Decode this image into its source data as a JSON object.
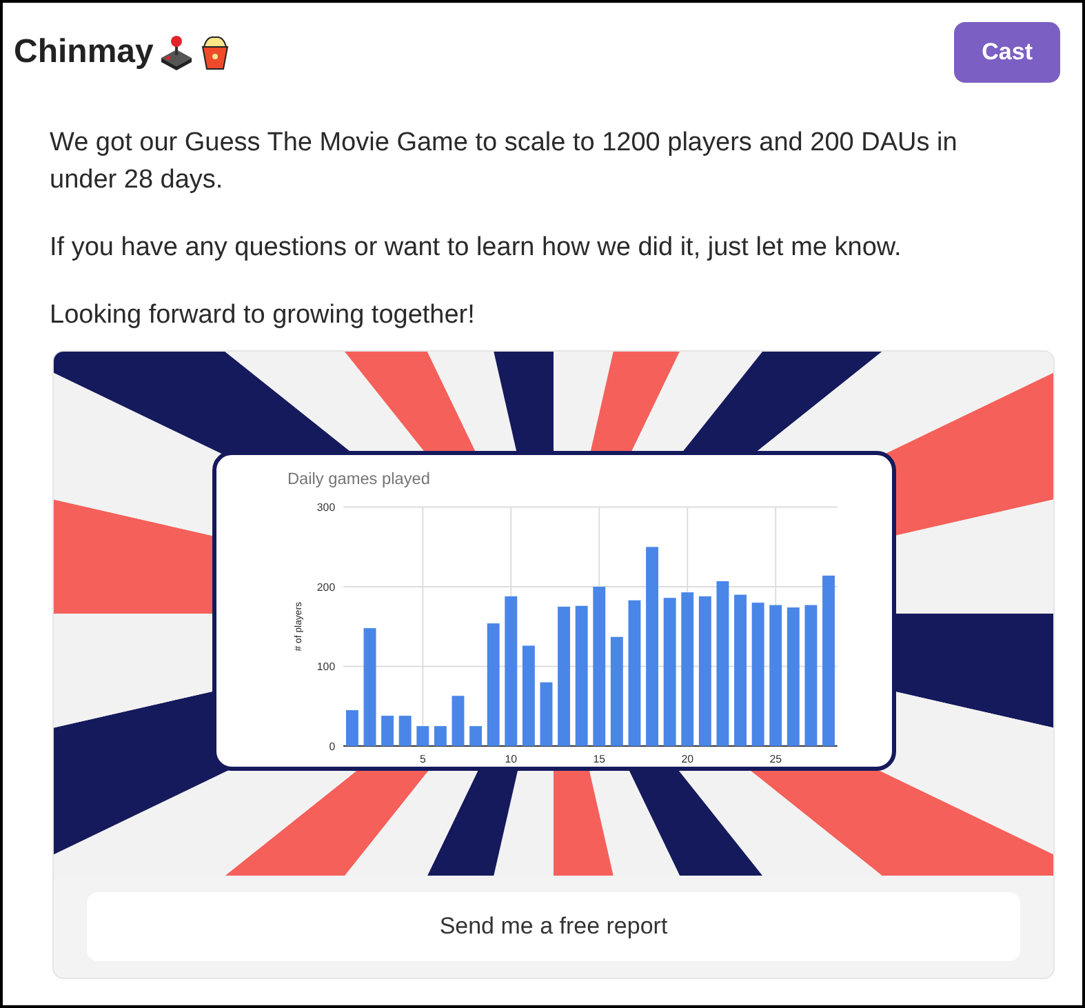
{
  "header": {
    "name": "Chinmay",
    "cast_button": "Cast"
  },
  "post": {
    "paragraphs": [
      "We got our Guess The Movie Game to scale to 1200 players and 200 DAUs in under 28 days.",
      "If you have any questions or want to learn how we did it, just let me know.",
      "Looking forward to growing together!"
    ]
  },
  "embed": {
    "chart_data": {
      "type": "bar",
      "title": "Daily games played",
      "ylabel": "# of players",
      "x": [
        1,
        2,
        3,
        4,
        5,
        6,
        7,
        8,
        9,
        10,
        11,
        12,
        13,
        14,
        15,
        16,
        17,
        18,
        19,
        20,
        21,
        22,
        23,
        24,
        25,
        26,
        27,
        28
      ],
      "series": [
        {
          "color": "#4a86e8",
          "values": [
            45,
            148,
            38,
            38,
            25,
            25,
            63,
            25,
            154,
            188,
            126,
            80,
            175,
            176,
            200,
            137,
            183,
            250,
            186,
            193,
            188,
            207,
            190,
            180,
            177,
            174,
            177,
            214
          ]
        }
      ],
      "xlim": [
        0.5,
        28.5
      ],
      "ylim": [
        0,
        300
      ],
      "grid": true,
      "yticks": [
        0,
        100,
        200,
        300
      ],
      "xticks": [
        5,
        10,
        15,
        20,
        25
      ]
    },
    "action_button": "Send me a free report"
  }
}
